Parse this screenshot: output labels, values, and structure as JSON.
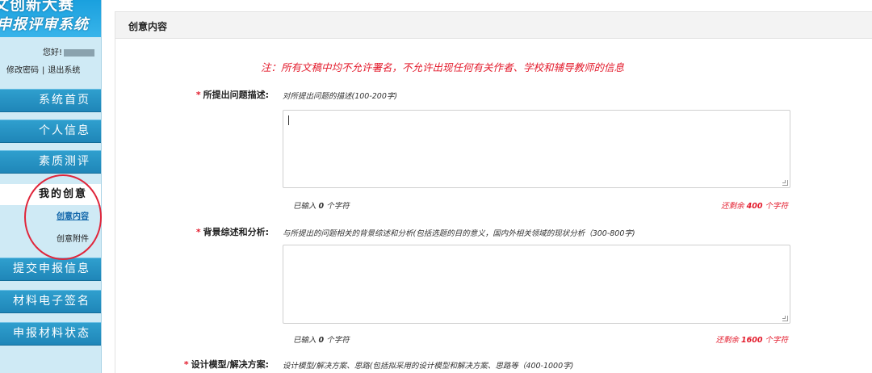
{
  "sidebar": {
    "logo_line1": "文创新大赛",
    "logo_line2": "申报评审系统",
    "greeting": "您好!",
    "change_password": "修改密码",
    "separator": "|",
    "logout": "退出系统",
    "nav": [
      {
        "label": "系统首页"
      },
      {
        "label": "个人信息"
      },
      {
        "label": "素质测评"
      }
    ],
    "my_ideas": "我的创意",
    "sub_items": [
      {
        "label": "创意内容"
      },
      {
        "label": "创意附件"
      }
    ],
    "nav_bottom": [
      {
        "label": "提交申报信息"
      },
      {
        "label": "材料电子签名"
      },
      {
        "label": "申报材料状态"
      }
    ]
  },
  "main": {
    "title": "创意内容",
    "notice": "注：所有文稿中均不允许署名，不允许出现任何有关作者、学校和辅导教师的信息",
    "fields": [
      {
        "star": "*",
        "label": "所提出问题描述:",
        "hint": "对所提出问题的描述(100-200字)",
        "value": "",
        "typed_prefix": "已输入",
        "typed_count": "0",
        "typed_suffix": "个字符",
        "remain_prefix": "还剩余",
        "remain_count": "400",
        "remain_suffix": "个字符"
      },
      {
        "star": "*",
        "label": "背景综述和分析:",
        "hint": "与所提出的问题相关的背景综述和分析(包括选题的目的意义，国内外相关领域的现状分析（300-800字)",
        "value": "",
        "typed_prefix": "已输入",
        "typed_count": "0",
        "typed_suffix": "个字符",
        "remain_prefix": "还剩余",
        "remain_count": "1600",
        "remain_suffix": "个字符"
      },
      {
        "star": "*",
        "label": "设计模型/解决方案:",
        "hint": "设计模型/解决方案、思路(包括拟采用的设计模型和解决方案、思路等（400-1000字)"
      }
    ]
  },
  "colors": {
    "accent": "#1f86b8",
    "notice": "#e31b2c",
    "sidebar_bg": "#cfeaf5"
  }
}
